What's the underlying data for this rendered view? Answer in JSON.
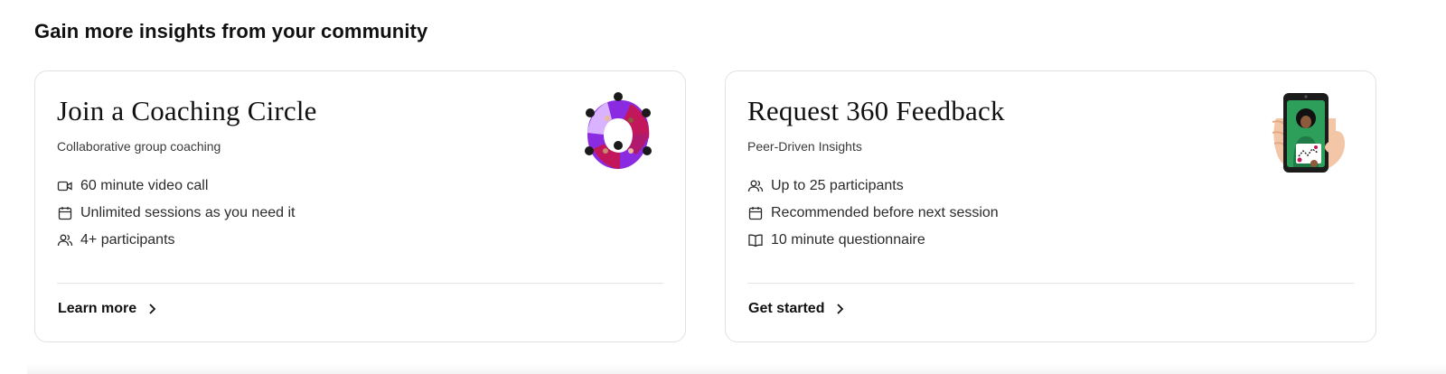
{
  "section": {
    "title": "Gain more insights from your community"
  },
  "cards": [
    {
      "title": "Join a Coaching Circle",
      "subtitle": "Collaborative group coaching",
      "features": [
        {
          "icon": "video-icon",
          "text": "60 minute video call"
        },
        {
          "icon": "calendar-icon",
          "text": "Unlimited sessions as you need it"
        },
        {
          "icon": "people-icon",
          "text": "4+ participants"
        }
      ],
      "link_label": "Learn more",
      "illustration": "coaching-circle-illustration"
    },
    {
      "title": "Request 360 Feedback",
      "subtitle": "Peer-Driven Insights",
      "features": [
        {
          "icon": "people-icon",
          "text": "Up to 25 participants"
        },
        {
          "icon": "calendar-icon",
          "text": "Recommended before next session"
        },
        {
          "icon": "book-icon",
          "text": "10 minute questionnaire"
        }
      ],
      "link_label": "Get started",
      "illustration": "phone-feedback-illustration"
    }
  ],
  "colors": {
    "card_border": "#e2e2e2",
    "text_primary": "#111111",
    "text_secondary": "#3a3a3a",
    "accent_purple": "#8a2be2",
    "accent_magenta": "#c2185b",
    "accent_green": "#2e9e5b"
  }
}
